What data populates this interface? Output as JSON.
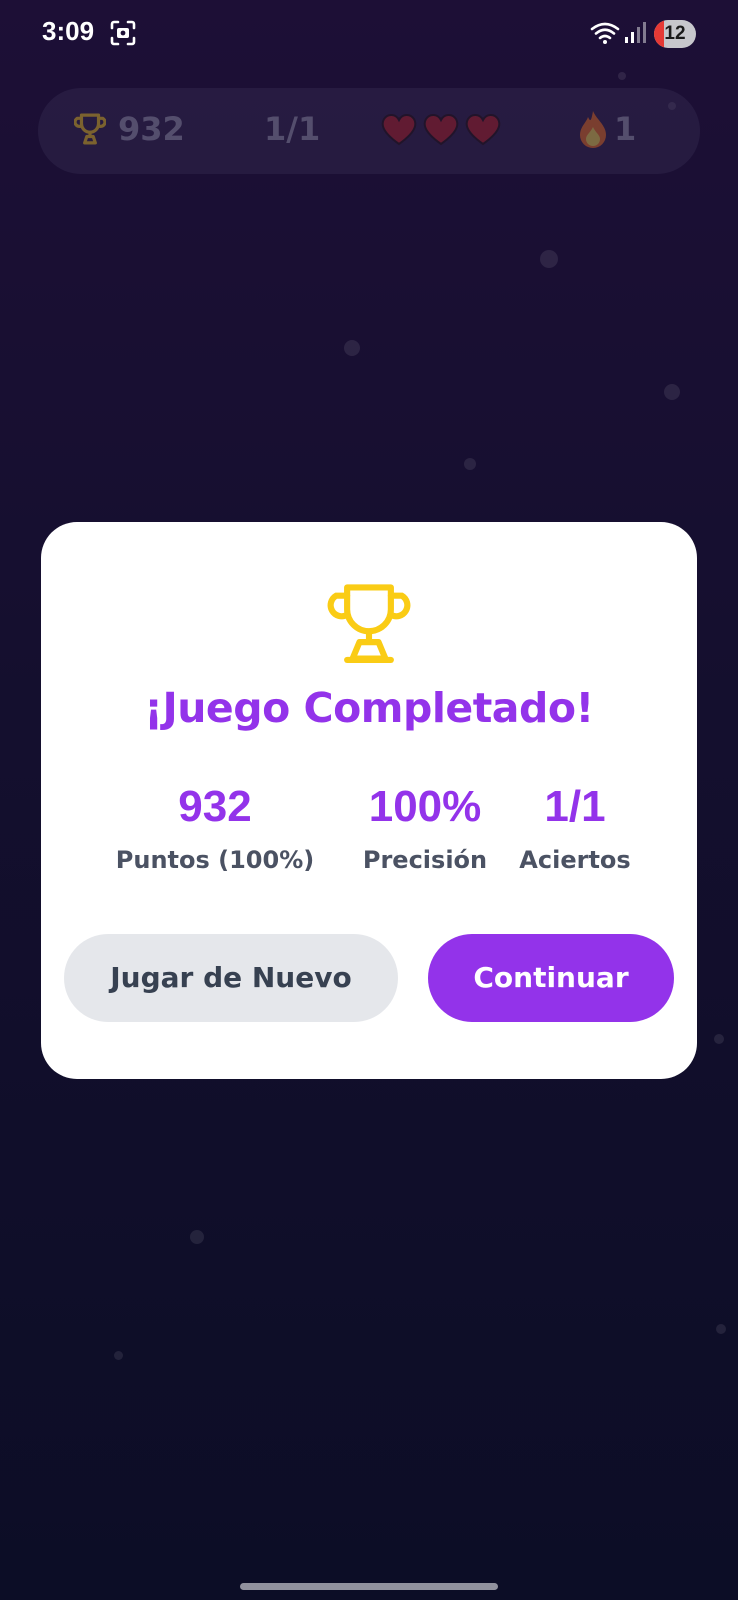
{
  "status_bar": {
    "time": "3:09",
    "battery": "12"
  },
  "hud": {
    "score": "932",
    "progress": "1/1",
    "lives": 3,
    "streak": "1"
  },
  "modal": {
    "title": "¡Juego Completado!",
    "stats": [
      {
        "value": "932",
        "label": "Puntos (100%)"
      },
      {
        "value": "100%",
        "label": "Precisión"
      },
      {
        "value": "1/1",
        "label": "Aciertos"
      }
    ],
    "play_again_label": "Jugar de Nuevo",
    "continue_label": "Continuar"
  },
  "colors": {
    "accent": "#9333ea",
    "trophy": "#facc15",
    "heart": "#b91c1c",
    "background_top": "#1d0f36",
    "background_bottom": "#0c0d26"
  }
}
